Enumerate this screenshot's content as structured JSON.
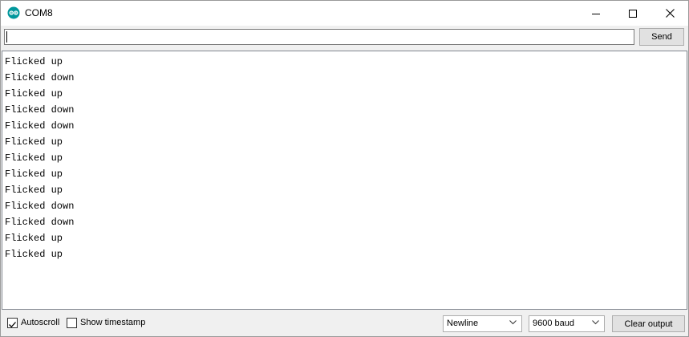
{
  "window": {
    "title": "COM8"
  },
  "input_row": {
    "input_value": "",
    "send_label": "Send"
  },
  "output": {
    "lines": [
      "Flicked up",
      "Flicked down",
      "Flicked up",
      "Flicked down",
      "Flicked down",
      "Flicked up",
      "Flicked up",
      "Flicked up",
      "Flicked up",
      "Flicked down",
      "Flicked down",
      "Flicked up",
      "Flicked up"
    ]
  },
  "bottom": {
    "autoscroll_label": "Autoscroll",
    "autoscroll_checked": true,
    "timestamp_label": "Show timestamp",
    "timestamp_checked": false,
    "line_ending": "Newline",
    "baud_rate": "9600 baud",
    "clear_label": "Clear output"
  },
  "colors": {
    "app_icon_teal": "#00979c"
  }
}
